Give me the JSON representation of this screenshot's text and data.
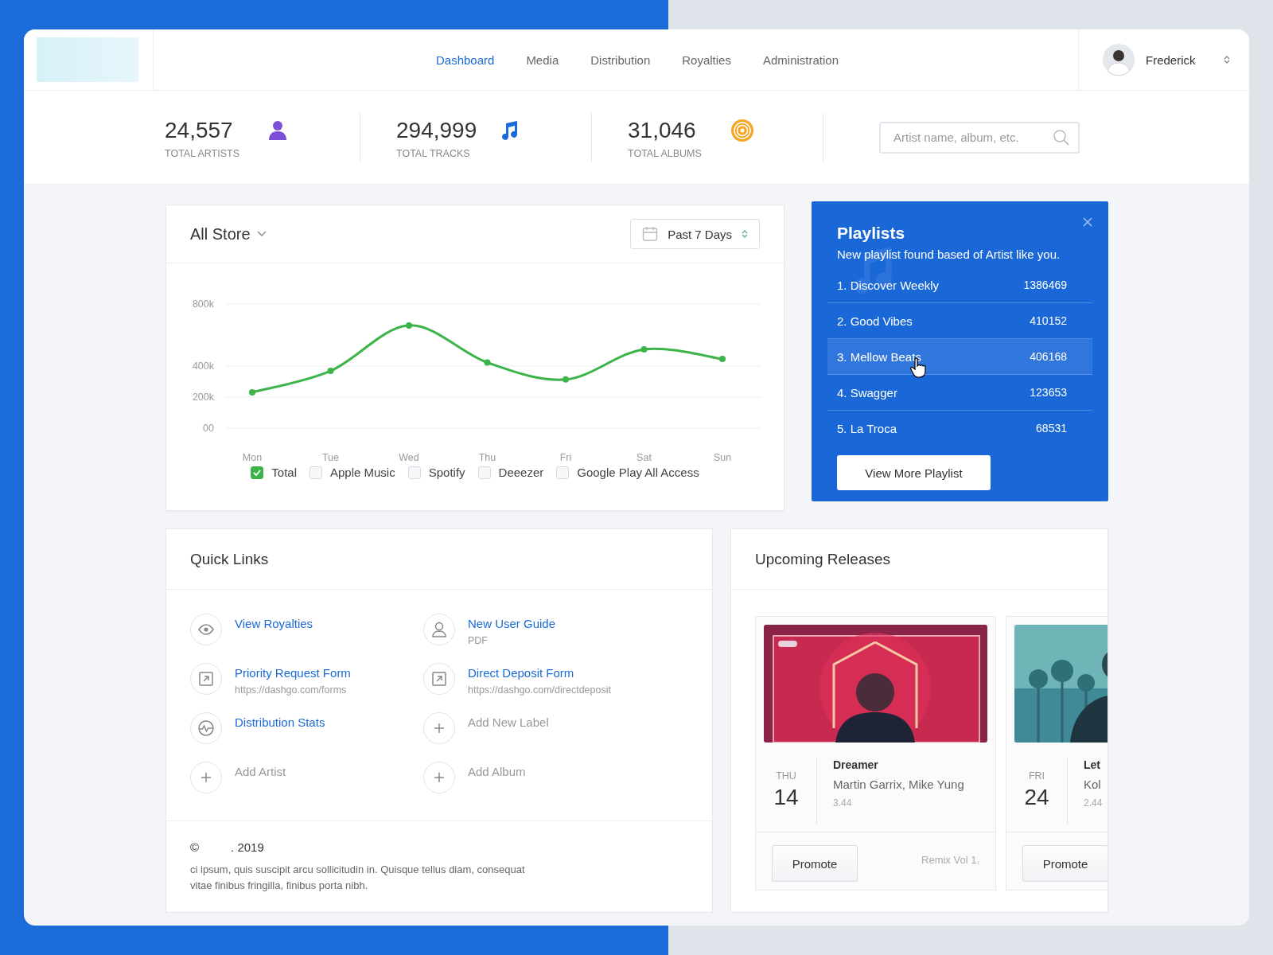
{
  "nav": {
    "items": [
      {
        "label": "Dashboard",
        "selected": true
      },
      {
        "label": "Media",
        "selected": false
      },
      {
        "label": "Distribution",
        "selected": false
      },
      {
        "label": "Royalties",
        "selected": false
      },
      {
        "label": "Administration",
        "selected": false
      }
    ]
  },
  "user": {
    "name": "Frederick"
  },
  "stats": [
    {
      "kind": "artists",
      "value": "24,557",
      "label": "TOTAL ARTISTS"
    },
    {
      "kind": "tracks",
      "value": "294,999",
      "label": "TOTAL TRACKS"
    },
    {
      "kind": "albums",
      "value": "31,046",
      "label": "TOTAL ALBUMS"
    }
  ],
  "search": {
    "placeholder": "Artist name, album, etc."
  },
  "sales": {
    "store": "All Store",
    "range": "Past 7 Days",
    "chart_data": {
      "type": "line",
      "categories": [
        "Mon",
        "Tue",
        "Wed",
        "Thu",
        "Fri",
        "Sat",
        "Sun"
      ],
      "series": [
        {
          "name": "Total",
          "color": "#3cb44a",
          "marker": "circle",
          "values": [
            231000,
            369000,
            662000,
            423000,
            314000,
            508000,
            446000
          ]
        }
      ],
      "ylim": [
        0,
        800000
      ],
      "yticks": [
        {
          "value": 0,
          "label": "00"
        },
        {
          "value": 200000,
          "label": "200k"
        },
        {
          "value": 400000,
          "label": "400k"
        },
        {
          "value": 800000,
          "label": "800k"
        }
      ]
    },
    "legend": [
      {
        "checked": true
      },
      {
        "label": "Apple Music",
        "checked": false
      },
      {
        "label": "Spotify",
        "checked": false
      },
      {
        "label": "Deeezer",
        "checked": false
      },
      {
        "label": "Google Play All Access",
        "checked": false
      }
    ]
  },
  "playlists": {
    "title": "Playlists",
    "subtitle": "New playlist found based of Artist like you.",
    "items": [
      {
        "name": "1. Discover Weekly",
        "count": "1386469",
        "selected": false
      },
      {
        "name": "2. Good Vibes",
        "count": "410152",
        "selected": false
      },
      {
        "name": "3. Mellow Beats",
        "count": "406168",
        "selected": true
      },
      {
        "name": "4. Swagger",
        "count": "123653",
        "selected": false
      },
      {
        "name": "5. La Troca",
        "count": "68531",
        "selected": false
      }
    ],
    "button": "View More Playlist"
  },
  "quick_links": {
    "title": "Quick Links",
    "items": [
      {
        "kind": "view",
        "label": "View Royalties"
      },
      {
        "kind": "guide",
        "label": "New User Guide",
        "sub": "PDF"
      },
      {
        "kind": "form",
        "label": "Priority Request Form",
        "sub": "https://dashgo.com/forms"
      },
      {
        "kind": "form",
        "label": "Direct Deposit Form",
        "sub": "https://dashgo.com/directdeposit"
      },
      {
        "kind": "stats",
        "label": "Distribution Stats"
      },
      {
        "kind": "add",
        "label": "Add New Label"
      },
      {
        "kind": "add",
        "label": "Add Artist"
      },
      {
        "kind": "add",
        "label": "Add Album"
      }
    ],
    "footer": {
      "symbol": "©",
      "year": ". 2019",
      "text": "ci ipsum, quis suscipit arcu sollicitudin in. Quisque tellus diam, consequat vitae finibus fringilla, finibus porta nibh."
    }
  },
  "upcoming": {
    "title": "Upcoming Releases",
    "releases": [
      {
        "kind": "neon",
        "day": "THU",
        "date": "14",
        "title": "Dreamer",
        "artists": "Martin Garrix, Mike Yung",
        "duration": "3.44",
        "button": "Promote",
        "note": "Remix Vol 1."
      },
      {
        "kind": "beach",
        "day": "FRI",
        "date": "24",
        "title": "Let",
        "artists": "Kol",
        "duration": "2.44",
        "button": "Promote"
      }
    ]
  }
}
